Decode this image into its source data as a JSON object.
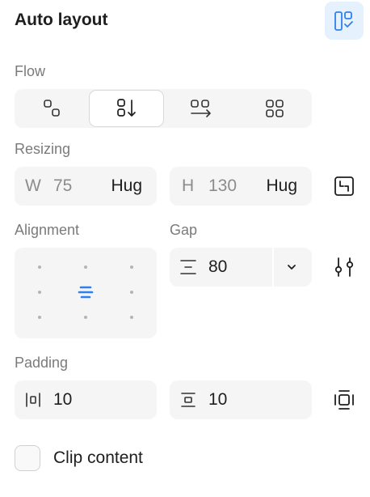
{
  "header": {
    "title": "Auto layout",
    "toggle_icon": "auto-layout-icon"
  },
  "flow": {
    "label": "Flow",
    "options": [
      {
        "name": "freeform",
        "icon": "flow-freeform-icon"
      },
      {
        "name": "vertical",
        "icon": "flow-vertical-icon",
        "active": true
      },
      {
        "name": "horizontal",
        "icon": "flow-horizontal-icon"
      },
      {
        "name": "grid",
        "icon": "flow-grid-icon"
      }
    ]
  },
  "resizing": {
    "label": "Resizing",
    "width": {
      "label": "W",
      "value": "75",
      "mode": "Hug"
    },
    "height": {
      "label": "H",
      "value": "130",
      "mode": "Hug"
    }
  },
  "alignment": {
    "label": "Alignment",
    "selected": "center-center"
  },
  "gap": {
    "label": "Gap",
    "value": "80"
  },
  "padding": {
    "label": "Padding",
    "horizontal": "10",
    "vertical": "10"
  },
  "clip": {
    "label": "Clip content",
    "checked": false
  },
  "colors": {
    "accent": "#2f80ed",
    "field_bg": "#f5f5f5",
    "toggle_bg": "#e5f1fd"
  }
}
